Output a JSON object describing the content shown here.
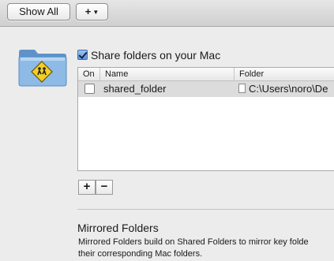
{
  "toolbar": {
    "show_all_label": "Show All",
    "add_label": "+"
  },
  "sharing": {
    "share_checkbox_label": "Share folders on your Mac",
    "share_checked": true
  },
  "table": {
    "columns": [
      "On",
      "Name",
      "Folder"
    ],
    "rows": [
      {
        "on": false,
        "name": "shared_folder",
        "folder": "C:\\Users\\noro\\De"
      }
    ]
  },
  "list_controls": {
    "add": "+",
    "remove": "−"
  },
  "mirrored": {
    "title": "Mirrored Folders",
    "description_line1": "Mirrored Folders build on Shared Folders to mirror key folde",
    "description_line2": "their corresponding Mac folders."
  },
  "colors": {
    "folder_blue": "#7faedc",
    "badge_yellow": "#f2cf28"
  }
}
